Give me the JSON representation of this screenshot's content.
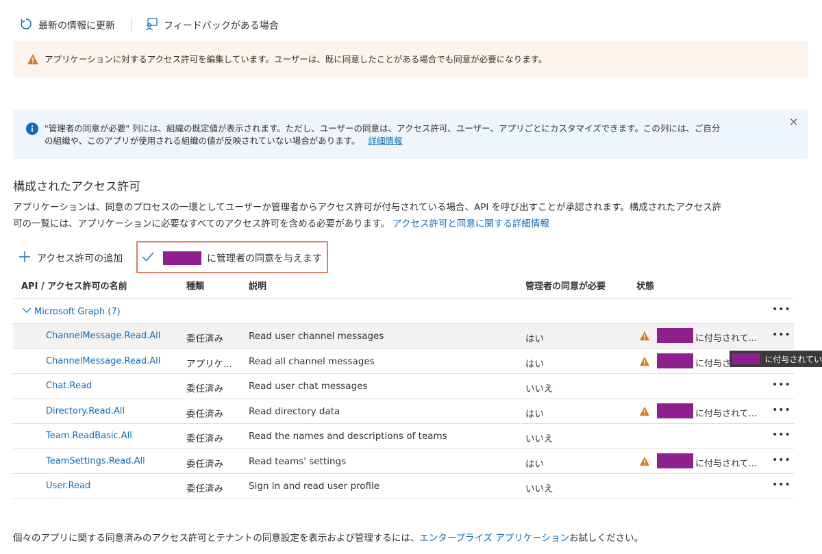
{
  "toolbar": {
    "refresh_label": "最新の情報に更新",
    "feedback_label": "フィードバックがある場合"
  },
  "warning_banner": {
    "text": "アプリケーションに対するアクセス許可を編集しています。ユーザーは、既に同意したことがある場合でも同意が必要になります。"
  },
  "info_banner": {
    "line1": "\"管理者の同意が必要\" 列には、組織の既定値が表示されます。ただし、ユーザーの同意は、アクセス許可、ユーザー、アプリごとにカスタマイズできます。この列には、ご自分",
    "line2": "の組織や、このアプリが使用される組織の値が反映されていない場合があります。",
    "link": "詳細情報",
    "close": "×"
  },
  "section": {
    "title": "構成されたアクセス許可",
    "desc_line1": "アプリケーションは、同意のプロセスの一環としてユーザーか管理者からアクセス許可が付与されている場合、API を呼び出すことが承認されます。構成されたアクセス許",
    "desc_line2": "可の一覧には、アプリケーションに必要なすべてのアクセス許可を含める必要があります。",
    "desc_link": "アクセス許可と同意に関する詳細情報"
  },
  "commands": {
    "add_label": "アクセス許可の追加",
    "grant_suffix": "に管理者の同意を与えます"
  },
  "table": {
    "headers": {
      "name": "API / アクセス許可の名前",
      "type": "種類",
      "description": "説明",
      "admin": "管理者の同意が必要",
      "status": "状態"
    },
    "group": "Microsoft Graph (7)",
    "more": "•••",
    "rows": [
      {
        "name": "ChannelMessage.Read.All",
        "type": "委任済み",
        "description": "Read user channel messages",
        "admin": "はい",
        "status": "に付与されて..."
      },
      {
        "name": "ChannelMessage.Read.All",
        "type": "アプリケ...",
        "description": "Read all channel messages",
        "admin": "はい",
        "status": "に付与さ"
      },
      {
        "name": "Chat.Read",
        "type": "委任済み",
        "description": "Read user chat messages",
        "admin": "いいえ",
        "status": ""
      },
      {
        "name": "Directory.Read.All",
        "type": "委任済み",
        "description": "Read directory data",
        "admin": "はい",
        "status": "に付与されて..."
      },
      {
        "name": "Team.ReadBasic.All",
        "type": "委任済み",
        "description": "Read the names and descriptions of teams",
        "admin": "いいえ",
        "status": ""
      },
      {
        "name": "TeamSettings.Read.All",
        "type": "委任済み",
        "description": "Read teams' settings",
        "admin": "はい",
        "status": "に付与されて..."
      },
      {
        "name": "User.Read",
        "type": "委任済み",
        "description": "Sign in and read user profile",
        "admin": "いいえ",
        "status": ""
      }
    ],
    "tooltip": "に付与されてい"
  },
  "footer": {
    "text": "個々のアプリに関する同意済みのアクセス許可とテナントの同意設定を表示および管理するには、",
    "link": "エンタープライズ アプリケーション",
    "suffix": "お試しください。"
  },
  "colors": {
    "link": "#0f6cbd",
    "warning": "#d67f1a",
    "redaction": "#8e1f8e",
    "highlight": "#e37a6a"
  }
}
